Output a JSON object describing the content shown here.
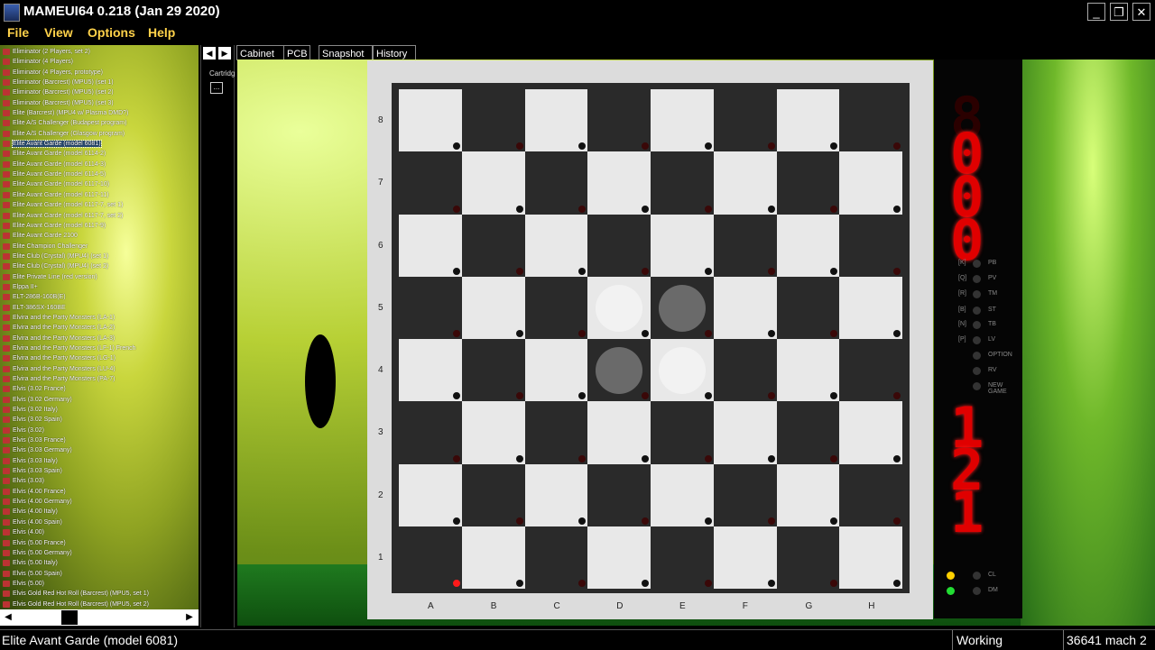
{
  "window": {
    "title": "MAMEUI64 0.218 (Jan 29 2020)",
    "minimize": "_",
    "restore": "❐",
    "close": "✕"
  },
  "menu": [
    "File",
    "View",
    "Options",
    "Help"
  ],
  "gamelist": [
    "Eliminator (2 Players, set 2)",
    "Eliminator (4 Players)",
    "Eliminator (4 Players, prototype)",
    "Eliminator (Barcrest) (MPU5) (set 1)",
    "Eliminator (Barcrest) (MPU5) (set 2)",
    "Eliminator (Barcrest) (MPU5) (set 3)",
    "Elite (Barcrest) (MPU4 w/ Plasma DMD?)",
    "Elite A/S Challenger (Budapest program)",
    "Elite A/S Challenger (Glasgow program)",
    "Elite Avant Garde (model 6081)",
    "Elite Avant Garde (model 6114-2)",
    "Elite Avant Garde (model 6114-3)",
    "Elite Avant Garde (model 6114-5)",
    "Elite Avant Garde (model 6117-10)",
    "Elite Avant Garde (model 6117-11)",
    "Elite Avant Garde (model 6117-7, set 1)",
    "Elite Avant Garde (model 6117-7, set 2)",
    "Elite Avant Garde (model 6117-9)",
    "Elite Avant Garde 2100",
    "Elite Champion Challenger",
    "Elite Club (Crystal) (MPU4) (set 1)",
    "Elite Club (Crystal) (MPU4) (set 2)",
    "Elite Private Line (red version)",
    "Elppa II+",
    "ELT-286B-160B(E)",
    "ELT-386SX-160BE",
    "Elvira and the Party Monsters (LA-1)",
    "Elvira and the Party Monsters (LA-2)",
    "Elvira and the Party Monsters (LA-3)",
    "Elvira and the Party Monsters (LF-1) French",
    "Elvira and the Party Monsters (LG-1)",
    "Elvira and the Party Monsters (LU-4)",
    "Elvira and the Party Monsters (PA-7)",
    "Elvis (3.02 France)",
    "Elvis (3.02 Germany)",
    "Elvis (3.02 Italy)",
    "Elvis (3.02 Spain)",
    "Elvis (3.02)",
    "Elvis (3.03 France)",
    "Elvis (3.03 Germany)",
    "Elvis (3.03 Italy)",
    "Elvis (3.03 Spain)",
    "Elvis (3.03)",
    "Elvis (4.00 France)",
    "Elvis (4.00 Germany)",
    "Elvis (4.00 Italy)",
    "Elvis (4.00 Spain)",
    "Elvis (4.00)",
    "Elvis (5.00 France)",
    "Elvis (5.00 Germany)",
    "Elvis (5.00 Italy)",
    "Elvis (5.00 Spain)",
    "Elvis (5.00)",
    "Elvis Gold Red Hot Roll (Barcrest) (MPU5, set 1)",
    "Elvis Gold Red Hot Roll (Barcrest) (MPU5, set 2)"
  ],
  "selected_index": 9,
  "mid": {
    "label": "Cartridg",
    "button": "..."
  },
  "tabs": [
    "Cabinet",
    "PCB",
    "Snapshot",
    "History"
  ],
  "board": {
    "ranks": [
      "8",
      "7",
      "6",
      "5",
      "4",
      "3",
      "2",
      "1"
    ],
    "files": [
      "A",
      "B",
      "C",
      "D",
      "E",
      "F",
      "G",
      "H"
    ],
    "pieces": [
      {
        "square": "D5",
        "color": "white"
      },
      {
        "square": "E5",
        "color": "black"
      },
      {
        "square": "D4",
        "color": "black"
      },
      {
        "square": "E4",
        "color": "white"
      }
    ],
    "highlight": "A1"
  },
  "led": {
    "digits_top": [
      "0",
      "0",
      "0"
    ],
    "digits_bottom": [
      "1",
      "2",
      "1"
    ],
    "labels": [
      "[K]",
      "[Q]",
      "[R]",
      "[B]",
      "[N]",
      "[P]",
      "PB",
      "PV",
      "TM",
      "ST",
      "TB",
      "LV",
      "OPTION",
      "RV",
      "NEW GAME",
      "CL",
      "DM"
    ],
    "accent_red": "#e00000"
  },
  "status": {
    "game": "Elite Avant Garde (model 6081)",
    "state": "Working",
    "count": "36641 mach 2"
  }
}
